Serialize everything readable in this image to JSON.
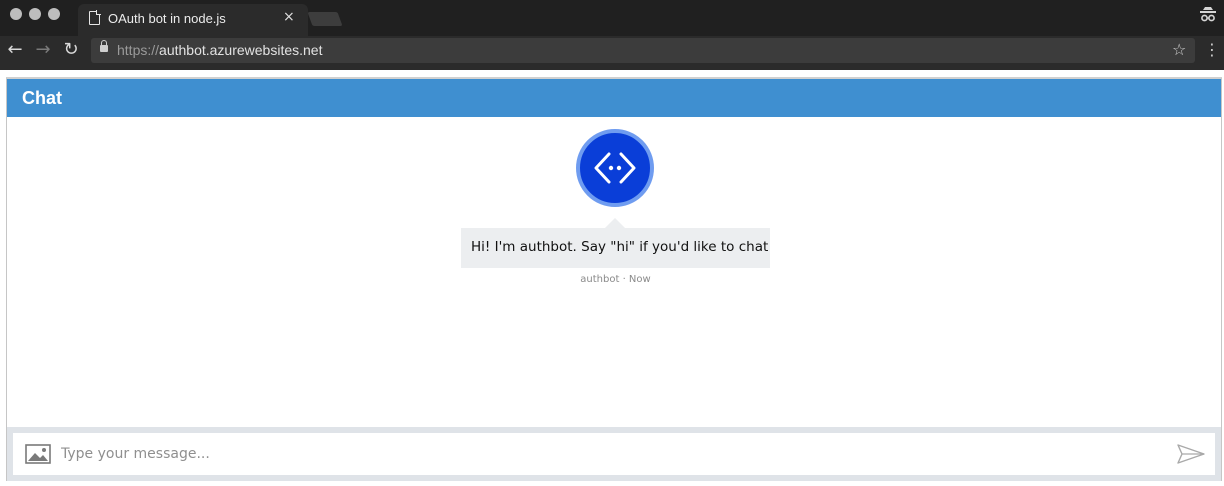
{
  "browser": {
    "tab_title": "OAuth bot in node.js",
    "tab_close": "×",
    "url_scheme": "https://",
    "url_host": "authbot.azurewebsites.net",
    "back_icon": "←",
    "forward_icon": "→",
    "reload_icon": "↻",
    "star_icon": "☆",
    "menu_icon": "⋮"
  },
  "chat": {
    "header_title": "Chat",
    "header_color": "#3f8fd0",
    "messages": [
      {
        "from": "authbot",
        "text": "Hi! I'm authbot. Say \"hi\" if you'd like to chat",
        "meta": "authbot · Now"
      }
    ],
    "input": {
      "placeholder": "Type your message...",
      "value": ""
    },
    "avatar_color": "#0a3ed8"
  }
}
